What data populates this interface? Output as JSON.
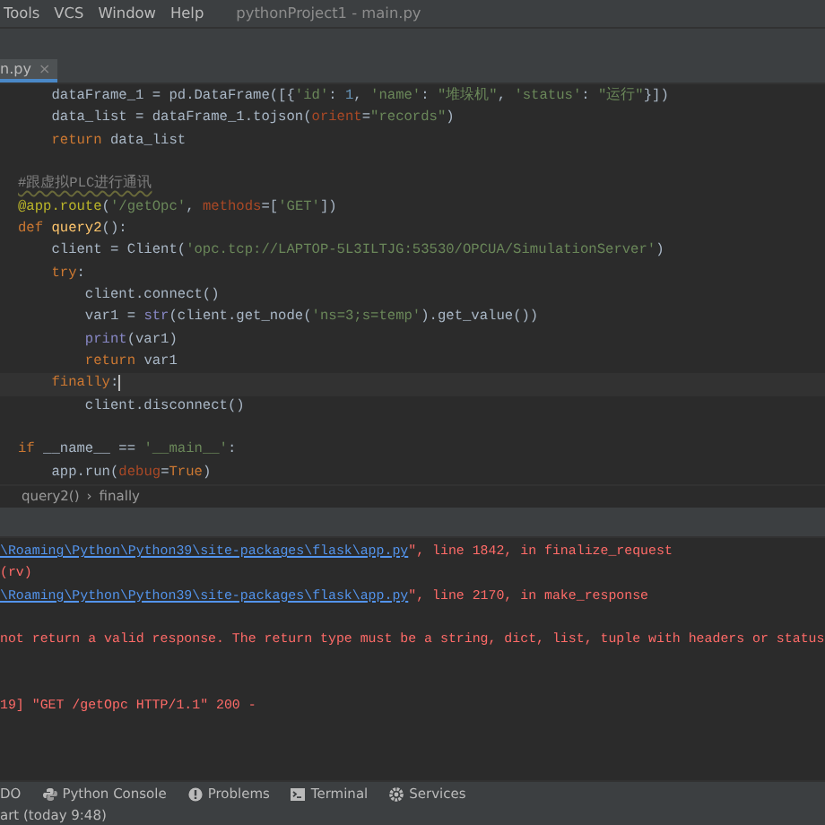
{
  "menu": [
    "Tools",
    "VCS",
    "Window",
    "Help"
  ],
  "window": {
    "title": "pythonProject1 - main.py"
  },
  "tabs": [
    {
      "label": "n.py",
      "close": "×",
      "selected": true
    }
  ],
  "code": [
    {
      "current": false,
      "tokens": [
        {
          "kind": "plain",
          "s": "    dataFrame_1 = pd.DataFrame([{"
        },
        {
          "kind": "str",
          "s": "'id'"
        },
        {
          "kind": "plain",
          "s": ": "
        },
        {
          "kind": "num",
          "s": "1"
        },
        {
          "kind": "plain",
          "s": ", "
        },
        {
          "kind": "str",
          "s": "'name'"
        },
        {
          "kind": "plain",
          "s": ": "
        },
        {
          "kind": "str",
          "s": "\"堆垛机\""
        },
        {
          "kind": "plain",
          "s": ", "
        },
        {
          "kind": "str",
          "s": "'status'"
        },
        {
          "kind": "plain",
          "s": ": "
        },
        {
          "kind": "str",
          "s": "\"运行\""
        },
        {
          "kind": "plain",
          "s": "}])"
        }
      ]
    },
    {
      "current": false,
      "tokens": [
        {
          "kind": "plain",
          "s": "    data_list = dataFrame_1.tojson("
        },
        {
          "kind": "param",
          "s": "orient"
        },
        {
          "kind": "plain",
          "s": "="
        },
        {
          "kind": "str",
          "s": "\"records\""
        },
        {
          "kind": "plain",
          "s": ")"
        }
      ]
    },
    {
      "current": false,
      "tokens": [
        {
          "kind": "kw",
          "s": "    return"
        },
        {
          "kind": "plain",
          "s": " data_list"
        }
      ]
    },
    {
      "current": false
    },
    {
      "current": false,
      "tokens": [
        {
          "kind": "comment",
          "s": "#跟虚拟PLC进行通讯"
        }
      ]
    },
    {
      "current": false,
      "tokens": [
        {
          "kind": "deco",
          "s": "@app.route"
        },
        {
          "kind": "plain",
          "s": "("
        },
        {
          "kind": "str",
          "s": "'/getOpc'"
        },
        {
          "kind": "plain",
          "s": ", "
        },
        {
          "kind": "param",
          "s": "methods"
        },
        {
          "kind": "plain",
          "s": "=["
        },
        {
          "kind": "str",
          "s": "'GET'"
        },
        {
          "kind": "plain",
          "s": "])"
        }
      ]
    },
    {
      "current": false,
      "tokens": [
        {
          "kind": "kw",
          "s": "def "
        },
        {
          "kind": "fn",
          "s": "query2"
        },
        {
          "kind": "plain",
          "s": "():"
        }
      ]
    },
    {
      "current": false,
      "tokens": [
        {
          "kind": "plain",
          "s": "    client = Client("
        },
        {
          "kind": "str",
          "s": "'opc.tcp://LAPTOP-5L3ILTJG:53530/OPCUA/SimulationServer'"
        },
        {
          "kind": "plain",
          "s": ")"
        }
      ]
    },
    {
      "current": false,
      "tokens": [
        {
          "kind": "kw",
          "s": "    try"
        },
        {
          "kind": "plain",
          "s": ":"
        }
      ]
    },
    {
      "current": false,
      "tokens": [
        {
          "kind": "plain",
          "s": "        client.connect()"
        }
      ]
    },
    {
      "current": false,
      "tokens": [
        {
          "kind": "plain",
          "s": "        var1 = "
        },
        {
          "kind": "builtin",
          "s": "str"
        },
        {
          "kind": "plain",
          "s": "(client.get_node("
        },
        {
          "kind": "str",
          "s": "'ns=3;s=temp'"
        },
        {
          "kind": "plain",
          "s": ").get_value())"
        }
      ]
    },
    {
      "current": false,
      "tokens": [
        {
          "kind": "builtin",
          "s": "        print"
        },
        {
          "kind": "plain",
          "s": "(var1)"
        }
      ]
    },
    {
      "current": false,
      "tokens": [
        {
          "kind": "kw",
          "s": "        return"
        },
        {
          "kind": "plain",
          "s": " var1"
        }
      ]
    },
    {
      "current": true,
      "tokens": [
        {
          "kind": "kw",
          "s": "    finally"
        },
        {
          "kind": "plain",
          "s": ":"
        }
      ]
    },
    {
      "current": false,
      "tokens": [
        {
          "kind": "plain",
          "s": "        client.disconnect()"
        }
      ]
    },
    {
      "current": false
    },
    {
      "current": false,
      "tokens": [
        {
          "kind": "kw",
          "s": "if"
        },
        {
          "kind": "plain",
          "s": " __name__ == "
        },
        {
          "kind": "str",
          "s": "'__main__'"
        },
        {
          "kind": "plain",
          "s": ":"
        }
      ]
    },
    {
      "current": false,
      "tokens": [
        {
          "kind": "plain",
          "s": "    app.run("
        },
        {
          "kind": "param",
          "s": "debug"
        },
        {
          "kind": "plain",
          "s": "="
        },
        {
          "kind": "kw",
          "s": "True"
        },
        {
          "kind": "plain",
          "s": ")"
        }
      ]
    }
  ],
  "breadcrumb": [
    "query2()",
    "›",
    "finally"
  ],
  "console": [
    {
      "kind": "trace",
      "link": "\\Roaming\\Python\\Python39\\site-packages\\flask\\app.py",
      "text": "\", line 1842, in finalize_request"
    },
    {
      "kind": "text",
      "text": "(rv)"
    },
    {
      "kind": "trace",
      "link": "\\Roaming\\Python\\Python39\\site-packages\\flask\\app.py",
      "text": "\", line 2170, in make_response"
    },
    {
      "kind": "blank"
    },
    {
      "kind": "text",
      "text": "not return a valid response. The return type must be a string, dict, list, tuple with headers or status"
    },
    {
      "kind": "blank"
    },
    {
      "kind": "blank"
    },
    {
      "kind": "text",
      "text": "19] \"GET /getOpc HTTP/1.1\" 200 -"
    }
  ],
  "tool_tabs": [
    "DO",
    "Python Console",
    "Problems",
    "Terminal",
    "Services"
  ],
  "status_bar": "art (today 9:48)"
}
